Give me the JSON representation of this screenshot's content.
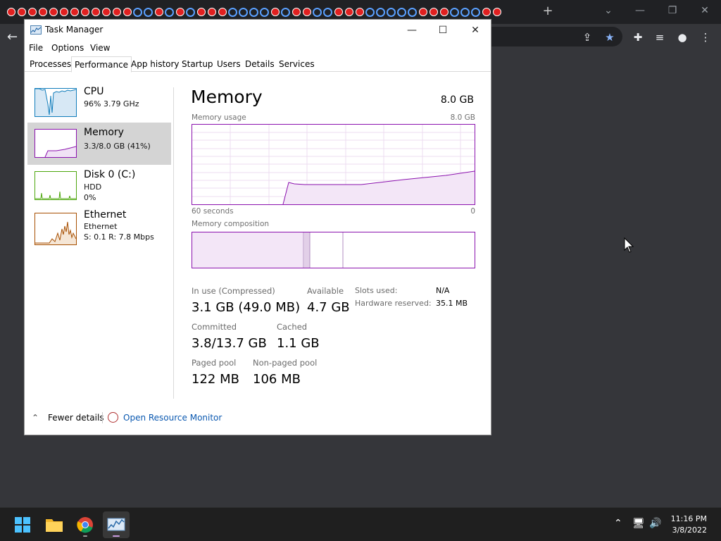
{
  "chrome": {
    "tab_favicons": [
      "yt",
      "yt",
      "yt",
      "yt",
      "yt",
      "yt",
      "yt",
      "yt",
      "yt",
      "yt",
      "yt",
      "yt",
      "ring",
      "ring",
      "yt",
      "ring",
      "yt",
      "ring",
      "yt",
      "yt",
      "yt",
      "ring",
      "ring",
      "ring",
      "ring",
      "yt",
      "ring",
      "yt",
      "yt",
      "ring",
      "ring",
      "yt",
      "yt",
      "yt",
      "ring",
      "ring",
      "ring",
      "ring",
      "ring",
      "yt",
      "yt",
      "yt",
      "ring",
      "ring",
      "ring",
      "yt",
      "yt"
    ],
    "new_tab_label": "+",
    "back_label": "←"
  },
  "task_manager": {
    "window_title": "Task Manager",
    "controls": {
      "minimize": "—",
      "maximize": "☐",
      "close": "✕"
    },
    "menu": [
      "File",
      "Options",
      "View"
    ],
    "tabs": [
      "Processes",
      "Performance",
      "App history",
      "Startup",
      "Users",
      "Details",
      "Services"
    ],
    "active_tab": "Performance",
    "sidebar": [
      {
        "title": "CPU",
        "sub1": "96%  3.79 GHz",
        "sub2": "",
        "sub3": ""
      },
      {
        "title": "Memory",
        "sub1": "3.3/8.0 GB (41%)",
        "sub2": "",
        "sub3": ""
      },
      {
        "title": "Disk 0 (C:)",
        "sub1": "HDD",
        "sub2": "0%",
        "sub3": ""
      },
      {
        "title": "Ethernet",
        "sub1": "Ethernet",
        "sub2": "S: 0.1  R: 7.8 Mbps",
        "sub3": ""
      }
    ],
    "memory": {
      "title": "Memory",
      "total": "8.0 GB",
      "usage_label": "Memory usage",
      "usage_max": "8.0 GB",
      "axis_left": "60 seconds",
      "axis_right": "0",
      "composition_label": "Memory composition",
      "stats": {
        "in_use_label": "In use (Compressed)",
        "in_use_value": "3.1 GB (49.0 MB)",
        "available_label": "Available",
        "available_value": "4.7 GB",
        "committed_label": "Committed",
        "committed_value": "3.8/13.7 GB",
        "cached_label": "Cached",
        "cached_value": "1.1 GB",
        "paged_label": "Paged pool",
        "paged_value": "122 MB",
        "nonpaged_label": "Non-paged pool",
        "nonpaged_value": "106 MB",
        "slots_label": "Slots used:",
        "slots_value": "N/A",
        "hw_label": "Hardware reserved:",
        "hw_value": "35.1 MB"
      }
    },
    "footer": {
      "fewer_details": "Fewer details",
      "resource_monitor": "Open Resource Monitor"
    }
  },
  "taskbar": {
    "clock_time": "11:16 PM",
    "clock_date": "3/8/2022"
  },
  "colors": {
    "memory_accent": "#8b12ae",
    "cpu_accent": "#117dbb",
    "disk_accent": "#4da60c",
    "ethernet_accent": "#a74f01",
    "link": "#0a58b0"
  }
}
